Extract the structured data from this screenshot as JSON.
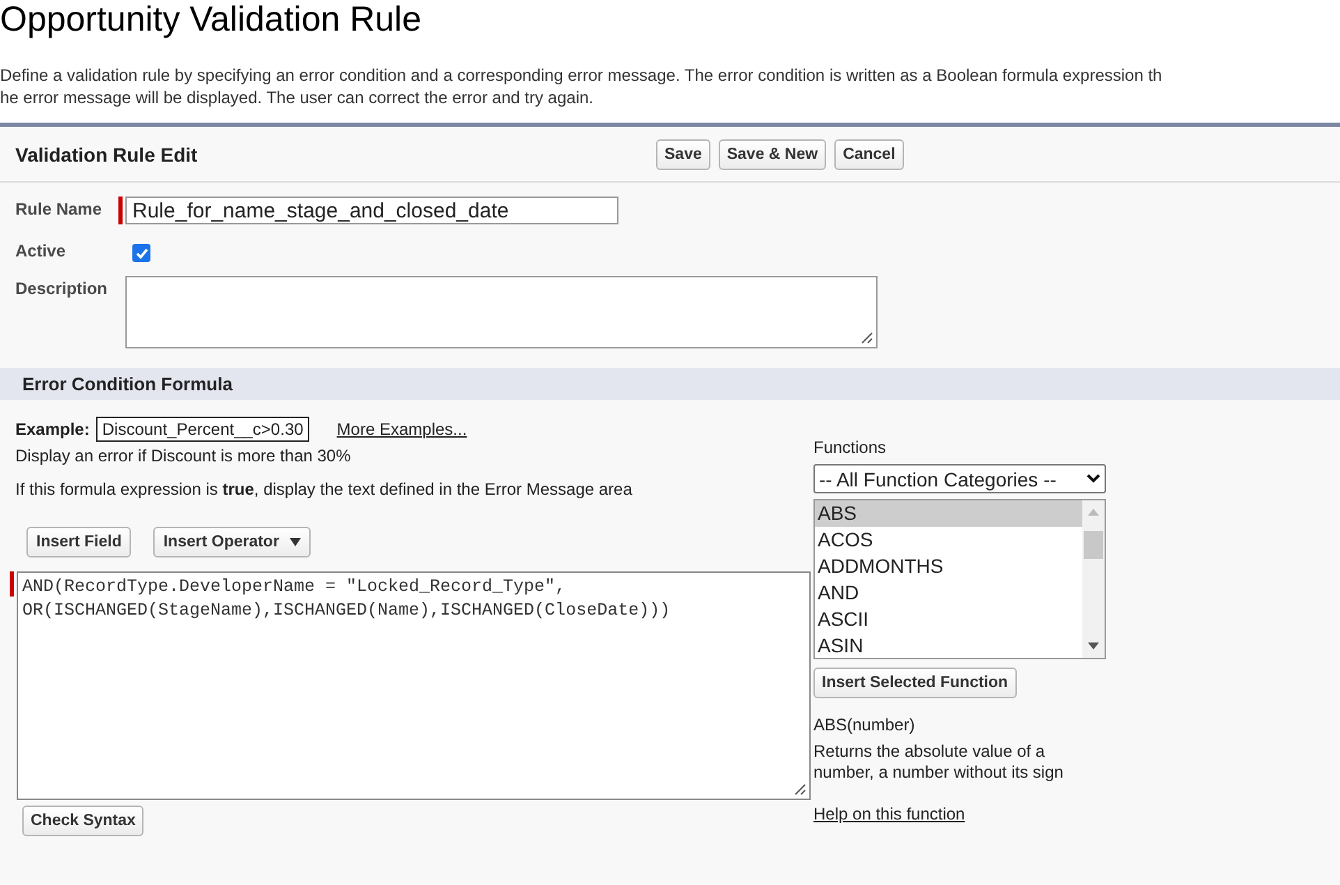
{
  "page": {
    "title": "Opportunity Validation Rule",
    "intro_lines": [
      "Define a validation rule by specifying an error condition and a corresponding error message. The error condition is written as a Boolean formula expression th",
      "he error message will be displayed. The user can correct the error and try again."
    ]
  },
  "edit_panel": {
    "title": "Validation Rule Edit",
    "buttons": [
      "Save",
      "Save & New",
      "Cancel"
    ],
    "fields": [
      {
        "kind": "text",
        "label": "Rule Name",
        "value": "Rule_for_name_stage_and_closed_date",
        "required": true
      },
      {
        "kind": "checkbox",
        "label": "Active",
        "checked": true
      },
      {
        "kind": "textarea",
        "label": "Description"
      }
    ]
  },
  "formula_section": {
    "title": "Error Condition Formula",
    "example_label": "Example:",
    "example_value": "Discount_Percent__c>0.30",
    "more_examples_link": "More Examples...",
    "example_note": "Display an error if Discount is more than 30%",
    "hint": "If this formula expression is **true**, display the text defined in the Error Message area",
    "insert_field_button": "Insert Field",
    "insert_operator_button": "Insert Operator",
    "formula": "AND(RecordType.DeveloperName = \"Locked_Record_Type\",\nOR(ISCHANGED(StageName),ISCHANGED(Name),ISCHANGED(CloseDate)))",
    "check_syntax_button": "Check Syntax",
    "functions": {
      "label": "Functions",
      "category": "-- All Function Categories --",
      "items": [
        {
          "label": "ABS",
          "selected": true
        },
        {
          "label": "ACOS",
          "selected": false
        },
        {
          "label": "ADDMONTHS",
          "selected": false
        },
        {
          "label": "AND",
          "selected": false
        },
        {
          "label": "ASCII",
          "selected": false
        },
        {
          "label": "ASIN",
          "selected": false
        }
      ],
      "insert_button": "Insert Selected Function",
      "signature": "ABS(number)",
      "description": "Returns the absolute value of a number, a number without its sign",
      "help_link": "Help on this function"
    }
  }
}
